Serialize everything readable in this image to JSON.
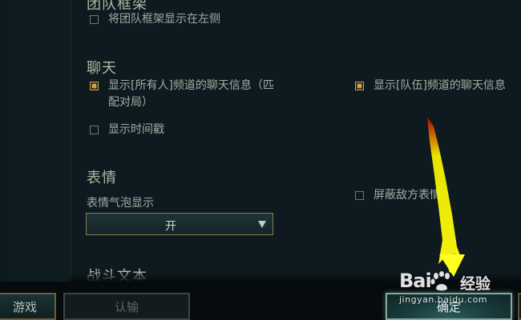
{
  "sections": {
    "team_frame": {
      "title": "团队框架",
      "option_left_sidebar": {
        "label": "将团队框架显示在左侧",
        "checked": false
      }
    },
    "chat": {
      "title": "聊天",
      "option_all_chat": {
        "label_line1": "显示[所有人]频道的聊天信息（匹",
        "label_line2": "配对局）",
        "checked": true
      },
      "option_team_chat": {
        "label": "显示[队伍]频道的聊天信息",
        "checked": true
      },
      "option_timestamps": {
        "label": "显示时间戳",
        "checked": false
      }
    },
    "emotes": {
      "title": "表情",
      "bubble_label": "表情气泡显示",
      "bubble_select_value": "开",
      "option_mute_enemy": {
        "label": "屏蔽敌方表情",
        "checked": false
      }
    },
    "combat_text": {
      "title": "战斗文本"
    }
  },
  "bottom_bar": {
    "game_button": "游戏",
    "surrender_button": "认输",
    "confirm_button": "确定"
  },
  "watermark": {
    "brand": "Bai",
    "brand2": "经验",
    "url": "jingyan.baidu.com"
  },
  "colors": {
    "accent_gold": "#d6a63a",
    "panel_bg": "#0e1a1f",
    "arrow_yellow": "#f4f000"
  },
  "icons": {
    "checkbox_checked": "gold-square-check-icon",
    "checkbox_unchecked": "empty-square-icon",
    "dropdown_arrow": "triangle-down-icon"
  }
}
